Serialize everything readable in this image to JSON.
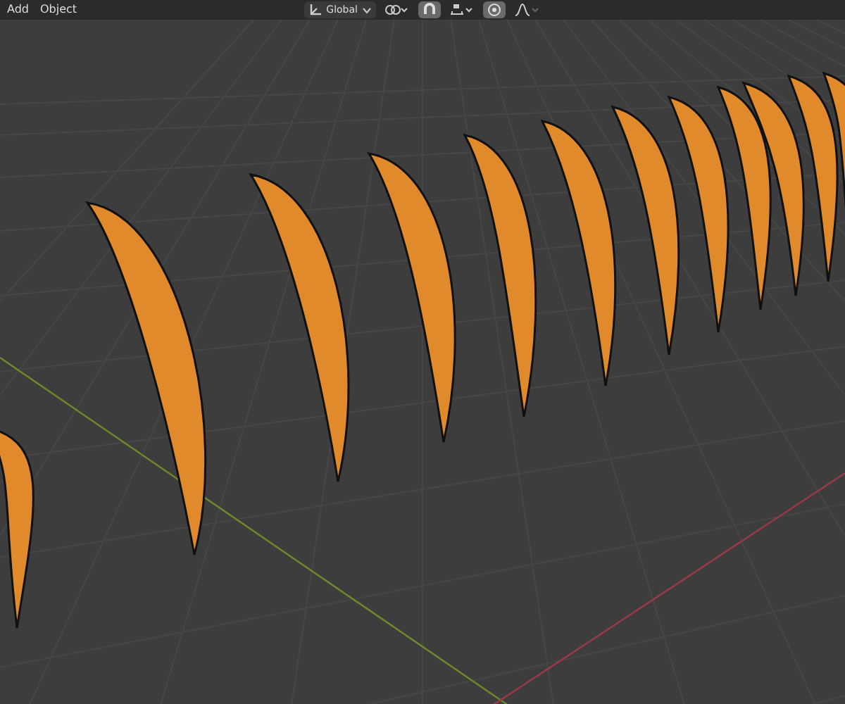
{
  "header": {
    "menus": [
      "Add",
      "Object"
    ],
    "transform_orientation": {
      "label": "Global"
    },
    "toggles": [
      {
        "kind": "snap",
        "selected": true
      },
      {
        "kind": "proportional",
        "selected": true
      }
    ]
  }
}
